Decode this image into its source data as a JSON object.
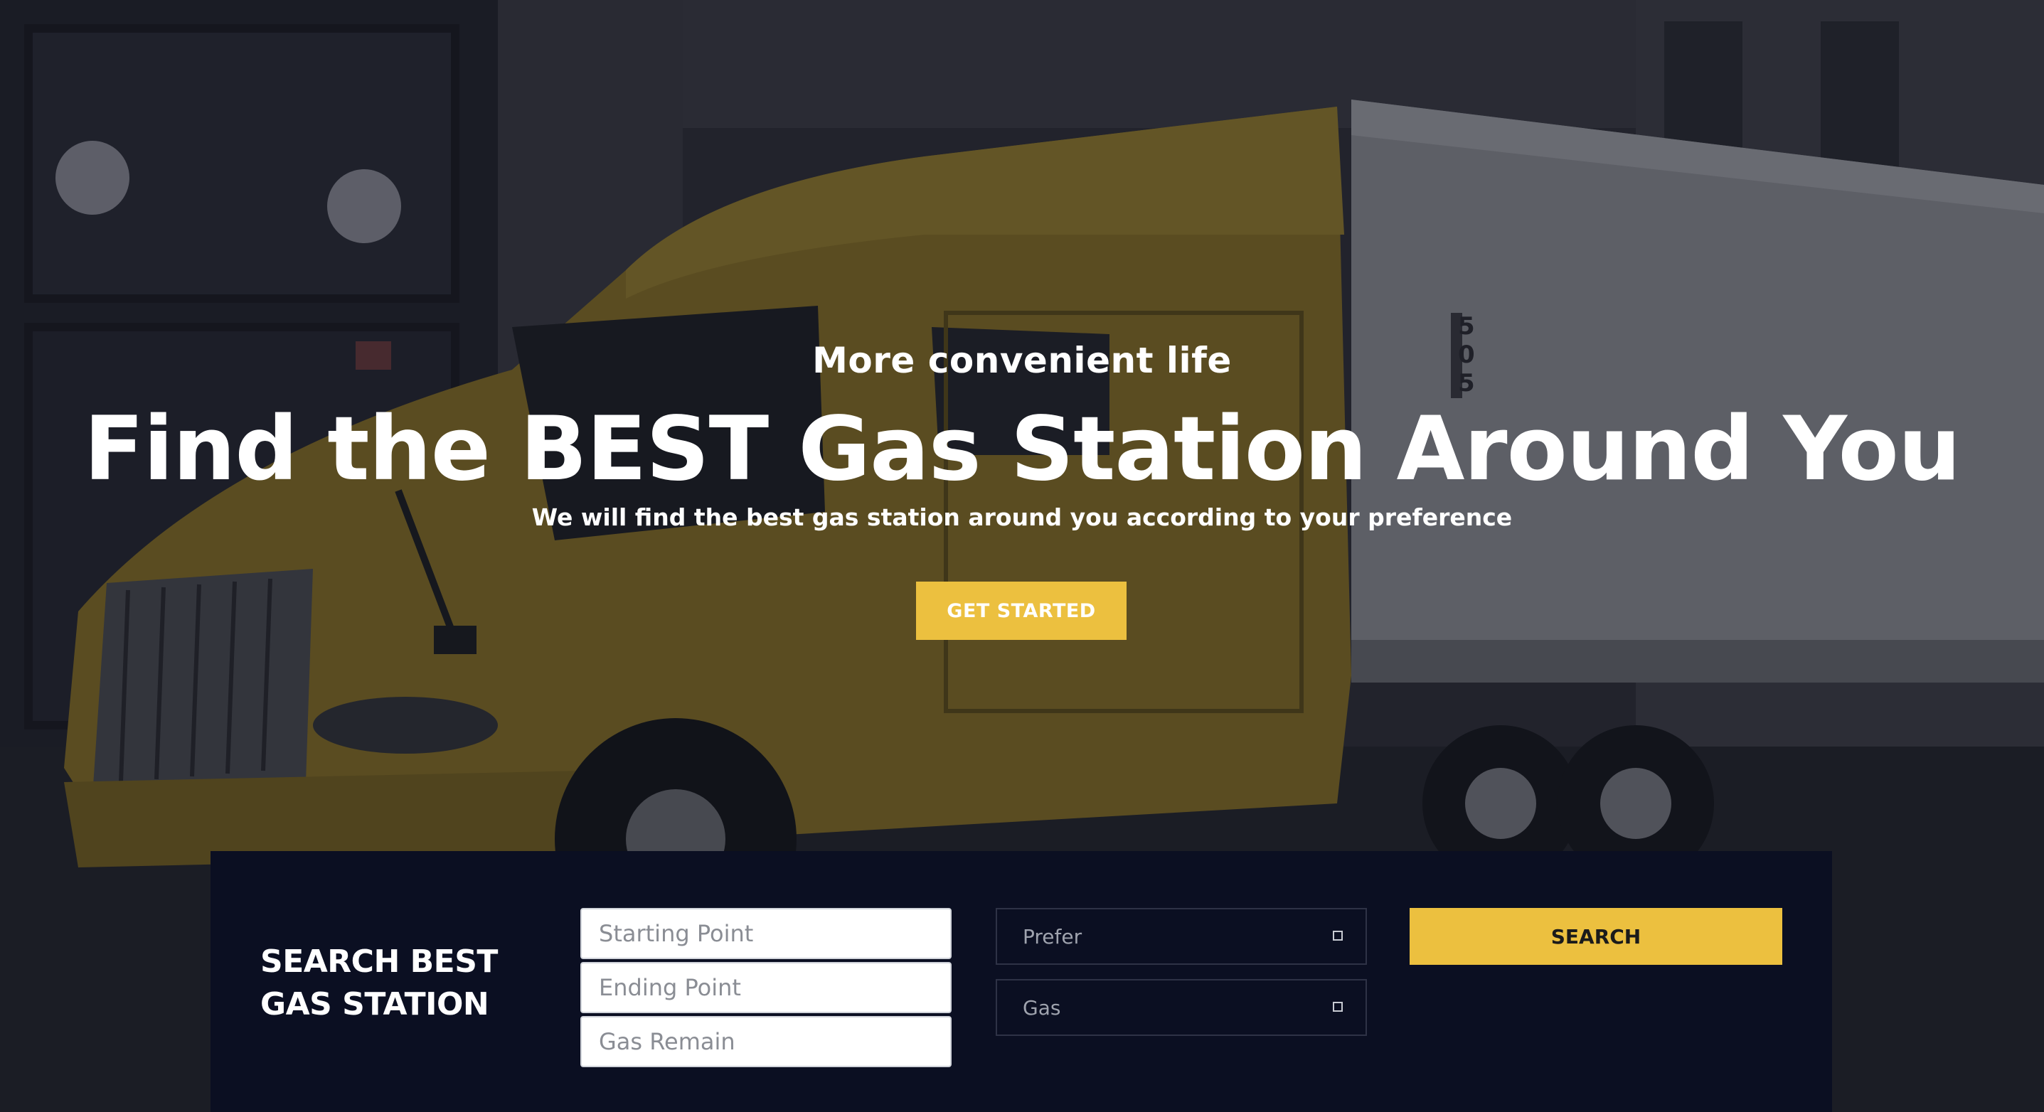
{
  "hero": {
    "tagline": "More convenient life",
    "headline": "Find the BEST Gas Station Around You",
    "subline": "We will find the best gas station around you according to your preference",
    "cta_label": "GET STARTED",
    "background_image": "yellow-semi-truck-photo",
    "truck_number": "5 0 5"
  },
  "search": {
    "title_line1": "SEARCH BEST",
    "title_line2": "GAS STATION",
    "starting_point_placeholder": "Starting Point",
    "ending_point_placeholder": "Ending Point",
    "gas_remain_placeholder": "Gas Remain",
    "prefer_select": "Prefer",
    "gas_select": "Gas",
    "search_label": "SEARCH"
  },
  "colors": {
    "accent": "#ECC03F",
    "panel": "#0B0F22",
    "text_light": "#FFFFFF"
  }
}
